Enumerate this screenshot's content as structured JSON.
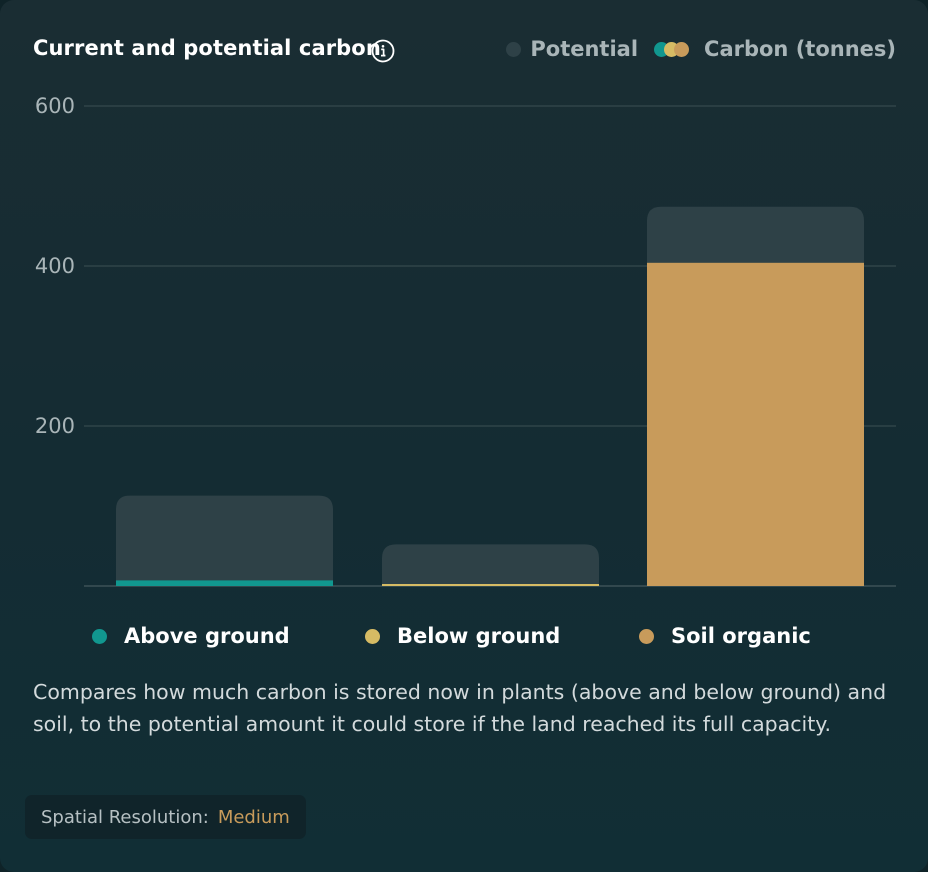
{
  "header": {
    "title": "Current and potential carbon",
    "info_icon": "info-icon"
  },
  "legend_top": {
    "potential_label": "Potential",
    "carbon_label": "Carbon (tonnes)"
  },
  "colors": {
    "potential": "#2e4147",
    "above_ground": "#11978f",
    "below_ground": "#d6bb64",
    "soil_organic": "#c89b5b",
    "gridline": "#35484d",
    "tick_text": "#a9b5b8",
    "highlight": "#c89b5b"
  },
  "chart_data": {
    "type": "bar",
    "title": "Current and potential carbon",
    "ylabel": "Carbon (tonnes)",
    "xlabel": "",
    "ylim": [
      0,
      600
    ],
    "y_ticks": [
      200,
      400,
      600
    ],
    "grid": true,
    "legend_position": "bottom",
    "categories": [
      "Above ground",
      "Below ground",
      "Soil organic"
    ],
    "series": [
      {
        "name": "Potential",
        "values": [
          113,
          52,
          474
        ]
      },
      {
        "name": "Carbon (tonnes)",
        "values": [
          7,
          2,
          404
        ]
      }
    ]
  },
  "legend_bottom": [
    {
      "label": "Above ground",
      "color_key": "above_ground"
    },
    {
      "label": "Below ground",
      "color_key": "below_ground"
    },
    {
      "label": "Soil organic",
      "color_key": "soil_organic"
    }
  ],
  "description": "Compares how much carbon is stored now in plants (above and below ground) and soil, to the potential amount it could store if the land reached its full capacity.",
  "badge": {
    "label": "Spatial Resolution:",
    "value": "Medium"
  }
}
